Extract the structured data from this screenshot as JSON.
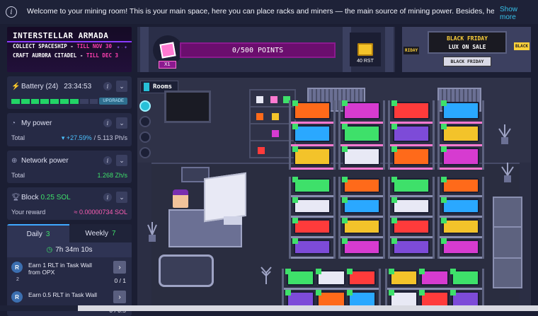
{
  "topbar": {
    "welcome": "Welcome to your mining room! This is your main space, here you can place racks and miners — the main source of mining power. Besides, here you can see",
    "show_more": "Show more"
  },
  "event": {
    "title": "INTERSTELLAR ARMADA",
    "line1_prefix": "COLLECT SPACESHIP - ",
    "line1_deadline": "TILL NOV 30",
    "line2_prefix": "CRAFT AURORA CITADEL - ",
    "line2_deadline": "TILL DEC 3"
  },
  "battery": {
    "label": "Battery (24)",
    "time": "23:34:53",
    "upgrade": "UPGRADE",
    "level_segments_on": 7,
    "segments_total": 9
  },
  "power": {
    "label": "My power",
    "total_label": "Total",
    "change": "▾ +27.59%",
    "value": "/ 5.113 Ph/s"
  },
  "network": {
    "label": "Network power",
    "total_label": "Total",
    "value": "1.268 Zh/s"
  },
  "block": {
    "label": "Block",
    "amount": "0.25 SOL",
    "reward_label": "Your reward",
    "reward_value": "≈ 0.00000734 SOL"
  },
  "tasks": {
    "tab_daily": "Daily",
    "tab_daily_count": "3",
    "tab_weekly": "Weekly",
    "tab_weekly_count": "7",
    "countdown": "7h 34m 10s",
    "items": [
      {
        "badge": "R",
        "num": "2",
        "text": "Earn 1 RLT in Task Wall from OPX",
        "progress": "0 / 1"
      },
      {
        "badge": "R",
        "num": "1",
        "text": "Earn 0.5 RLT in Task Wall",
        "progress": "0 / 0.5"
      }
    ]
  },
  "points": {
    "label": "0/500 POINTS",
    "multiplier": "X1",
    "reward": "40 RST"
  },
  "black_friday": {
    "title": "BLACK FRIDAY",
    "subtitle": "LUX ON SALE",
    "button": "BLACK FRIDAY",
    "side_left": "RIDAY",
    "side_right": "BLACK"
  },
  "room": {
    "rooms_button": "Rooms",
    "rack_colors": [
      "#ff7ad1",
      "#8a8fb0"
    ],
    "miner_colors": [
      "#ff6a1a",
      "#2aa8ff",
      "#f3c32a",
      "#d63bd0",
      "#3ee06a",
      "#e8e9f5",
      "#ff3b3b",
      "#7d4bd8"
    ]
  },
  "icons": {
    "info": "info-icon",
    "battery": "lightning-icon",
    "power": "speedometer-icon",
    "network": "network-icon",
    "block": "trophy-icon",
    "clock": "clock-icon",
    "chevron": "chevron-down-icon",
    "arrow": "chevron-right-icon"
  }
}
